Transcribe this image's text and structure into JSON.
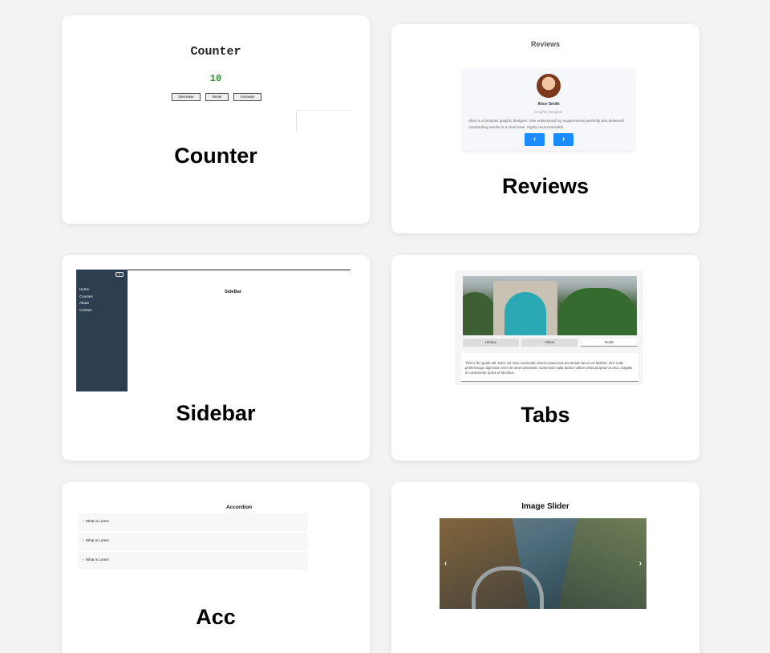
{
  "cards": {
    "counter": {
      "preview_title": "Counter",
      "preview_value": "10",
      "buttons": [
        "Decrease",
        "Reset",
        "Increase"
      ],
      "title": "Counter"
    },
    "reviews": {
      "preview_heading": "Reviews",
      "person_name": "Alice Smith",
      "person_role": "Graphic Designer",
      "review_text": "Alice is a fantastic graphic designer. She understood my requirements perfectly and delivered outstanding results in a short time. Highly recommended!",
      "prev_icon": "chevron-left-icon",
      "next_icon": "chevron-right-icon",
      "title": "Reviews"
    },
    "sidebar": {
      "close_label": "X",
      "items": [
        "Home",
        "Courses",
        "About",
        "Contact"
      ],
      "preview_label": "SideBar",
      "title": "Sidebar"
    },
    "tabs": {
      "tab_labels": [
        "History",
        "Vision",
        "Goals"
      ],
      "content_text": "This is the goals tab. Nunc vel risus commodo viverra maecenas accumsan lacus vel facilisis. Orci nulla pellentesque dignissim enim sit amet venenatis. Commodo nulla facilisi nullam vehicula ipsum a arcu. Sagittis id consectetur purus ut faucibus.",
      "title": "Tabs"
    },
    "accordion": {
      "preview_heading": "Accordion",
      "items": [
        "What is Lorem",
        "What is Lorem",
        "What is Lorem"
      ],
      "title": "Acc"
    },
    "slider": {
      "preview_heading": "Image Slider",
      "left_arrow": "‹",
      "right_arrow": "›"
    }
  },
  "colors": {
    "page_bg": "#f3f3f3",
    "counter_value": "#2e8b2e",
    "review_nav": "#1a8cff",
    "sidebar_bg": "#2d3e50"
  }
}
